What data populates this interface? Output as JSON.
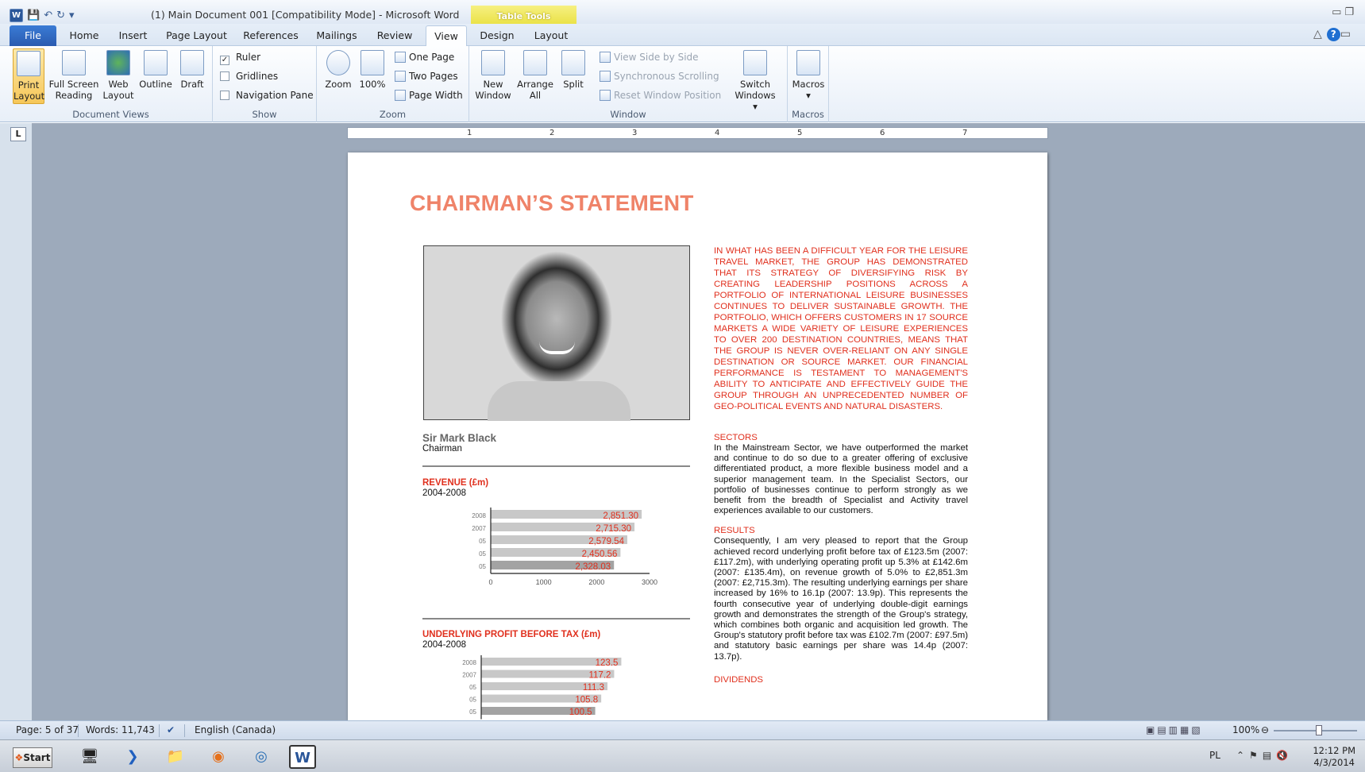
{
  "window": {
    "title": "(1) Main Document 001 [Compatibility Mode]  -  Microsoft Word",
    "context_tab_group": "Table Tools"
  },
  "tabs": [
    "File",
    "Home",
    "Insert",
    "Page Layout",
    "References",
    "Mailings",
    "Review",
    "View",
    "Design",
    "Layout"
  ],
  "active_tab": "View",
  "ribbon": {
    "document_views": {
      "label": "Document Views",
      "print_layout_l1": "Print",
      "print_layout_l2": "Layout",
      "full_screen_l1": "Full Screen",
      "full_screen_l2": "Reading",
      "web_layout_l1": "Web",
      "web_layout_l2": "Layout",
      "outline": "Outline",
      "draft": "Draft"
    },
    "show": {
      "label": "Show",
      "ruler": "Ruler",
      "ruler_checked": true,
      "gridlines": "Gridlines",
      "navigation_pane": "Navigation Pane"
    },
    "zoom": {
      "label": "Zoom",
      "zoom": "Zoom",
      "hundred": "100%",
      "one_page": "One Page",
      "two_pages": "Two Pages",
      "page_width": "Page Width"
    },
    "window": {
      "label": "Window",
      "new_window_l1": "New",
      "new_window_l2": "Window",
      "arrange_all_l1": "Arrange",
      "arrange_all_l2": "All",
      "split": "Split",
      "view_side_by_side": "View Side by Side",
      "synchronous_scrolling": "Synchronous Scrolling",
      "reset_window_position": "Reset Window Position",
      "switch_windows_l1": "Switch",
      "switch_windows_l2": "Windows"
    },
    "macros": {
      "label": "Macros",
      "macros": "Macros"
    }
  },
  "ruler": {
    "numbers": [
      "1",
      "2",
      "3",
      "4",
      "5",
      "6",
      "7"
    ]
  },
  "document": {
    "heading": "CHAIRMAN’S STATEMENT",
    "person_name": "Sir Mark Black",
    "person_role": "Chairman",
    "intro": "In what has been a difficult year for the leisure travel market, the Group has demonstrated that its strategy of diversifying risk by creating leadership positions across a portfolio of international leisure businesses continues to deliver sustainable growth. The portfolio, which offers customers in 17 source markets a wide variety of leisure experiences to over 200 destination countries, means that the Group is never over-reliant on any single destination or source market. Our financial performance is testament to management's ability to anticipate and effectively guide the Group through an unprecedented number of geo-political events and natural disasters.",
    "sections": [
      {
        "heading": "SECTORS",
        "text": "In the Mainstream Sector, we have outperformed the market and continue to do so due to a greater offering of exclusive differentiated product, a more flexible business model and a superior management team. In the Specialist Sectors, our portfolio of businesses continue to perform strongly as we benefit from the breadth of Specialist and Activity travel experiences available to our customers."
      },
      {
        "heading": "RESULTS",
        "text": "Consequently, I am very pleased to report that the Group achieved record underlying profit before tax of £123.5m (2007: £117.2m), with underlying operating profit up 5.3% at £142.6m (2007: £135.4m), on revenue growth of 5.0% to £2,851.3m (2007: £2,715.3m). The resulting underlying earnings per share increased by 16% to 16.1p (2007: 13.9p). This represents the fourth consecutive year of underlying double-digit earnings growth and demonstrates the strength of the Group's strategy, which combines both organic and acquisition led growth. The Group's statutory profit before tax was £102.7m (2007: £97.5m) and statutory basic earnings per share was 14.4p (2007: 13.7p)."
      },
      {
        "heading": "DIVIDENDS",
        "text": ""
      }
    ]
  },
  "chart_data": [
    {
      "type": "bar",
      "title": "REVENUE  (£m)",
      "subtitle": "2004-2008",
      "orientation": "horizontal",
      "categories": [
        "2008",
        "2007",
        "05",
        "05",
        "05"
      ],
      "values": [
        2851.3,
        2715.3,
        2579.54,
        2450.56,
        2328.03
      ],
      "value_labels": [
        "2,851.30",
        "2,715.30",
        "2,579.54",
        "2,450.56",
        "2,328.03"
      ],
      "xlim": [
        0,
        3000
      ],
      "xticks": [
        "0",
        "1000",
        "2000",
        "3000"
      ],
      "bar_color": "#c8c8c8",
      "label_color": "#e0301e"
    },
    {
      "type": "bar",
      "title": "UNDERLYING  PROFIT BEFORE  TAX (£m)",
      "subtitle": "2004-2008",
      "orientation": "horizontal",
      "categories": [
        "2008",
        "2007",
        "05",
        "05",
        "05"
      ],
      "values": [
        123.5,
        117.2,
        111.3,
        105.8,
        100.5
      ],
      "value_labels": [
        "123.5",
        "117.2",
        "111.3",
        "105.8",
        "100.5"
      ],
      "bar_color": "#c8c8c8",
      "label_color": "#e0301e"
    }
  ],
  "statusbar": {
    "page": "Page: 5 of 37",
    "words": "Words: 11,743",
    "language": "English (Canada)",
    "zoom": "100%"
  },
  "taskbar": {
    "start": "Start",
    "lang": "PL",
    "time": "12:12 PM",
    "date": "4/3/2014"
  }
}
